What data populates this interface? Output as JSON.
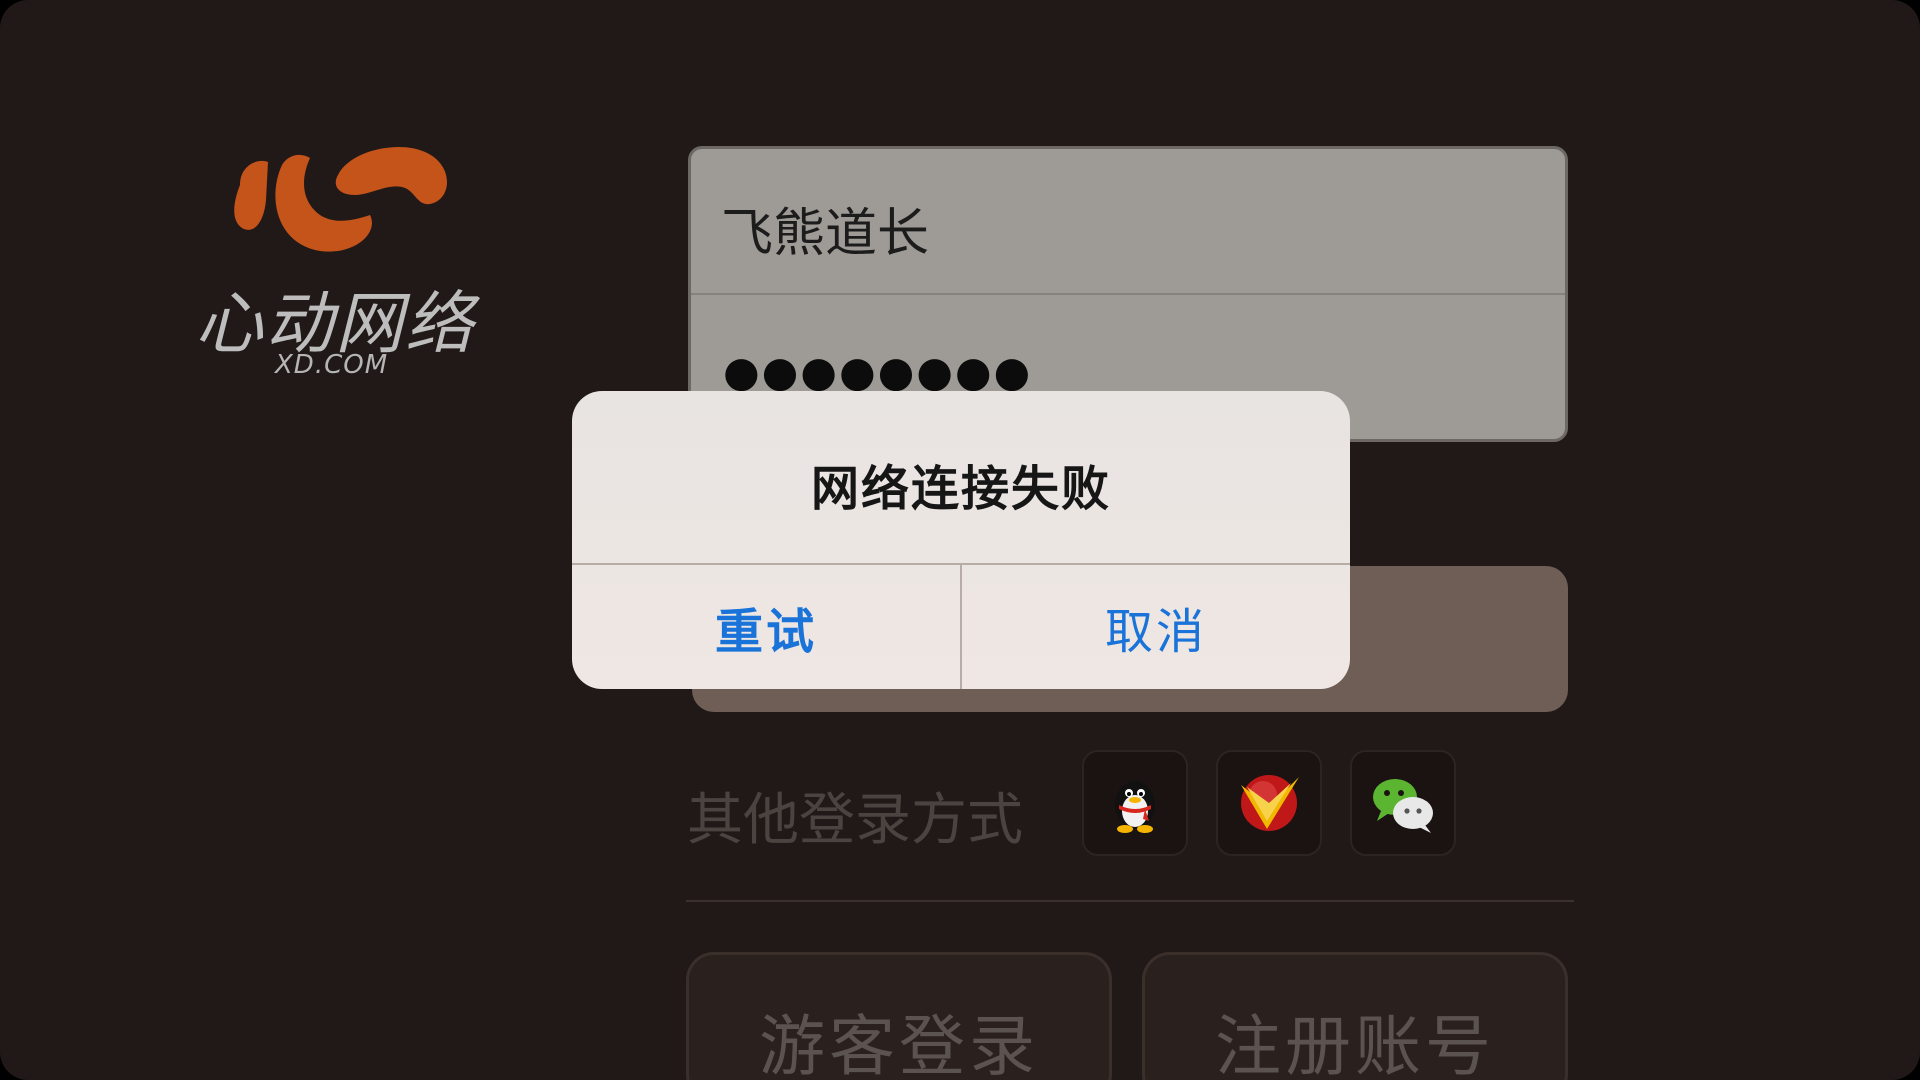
{
  "logo": {
    "brand_cn": "心动网络",
    "brand_en": "XD.COM",
    "mark_color": "#c4541a"
  },
  "login": {
    "username_value": "飞熊道长",
    "password_value": "●●●●●●●●"
  },
  "other_login": {
    "label": "其他登录方式",
    "methods": [
      {
        "icon": "qq-penguin-icon"
      },
      {
        "icon": "v-badge-icon"
      },
      {
        "icon": "wechat-icon"
      }
    ]
  },
  "bottom_buttons": {
    "guest_label": "游客登录",
    "register_label": "注册账号"
  },
  "dialog": {
    "title": "网络连接失败",
    "retry_label": "重试",
    "cancel_label": "取消",
    "button_color": "#1a73d9"
  }
}
